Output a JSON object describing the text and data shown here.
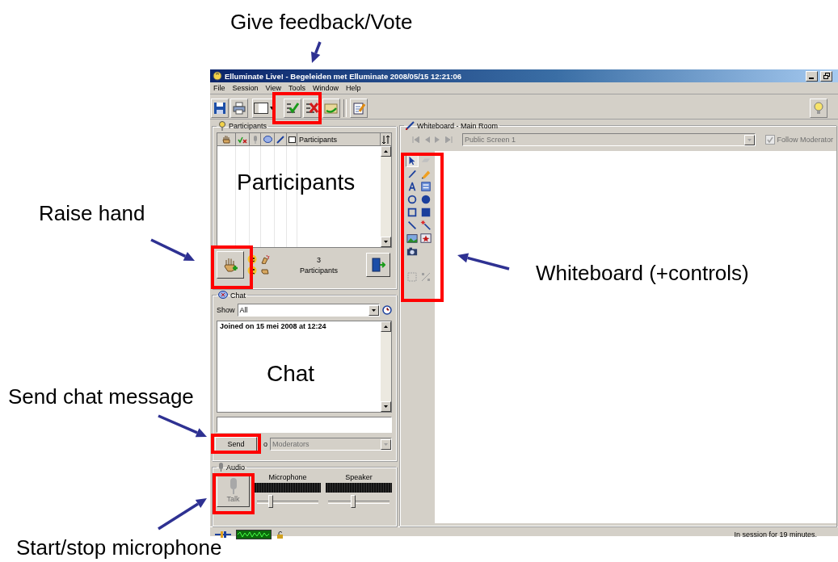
{
  "annotations": [
    {
      "text": "Give feedback/Vote"
    },
    {
      "text": "Participants"
    },
    {
      "text": "Raise hand"
    },
    {
      "text": "Whiteboard (+controls)"
    },
    {
      "text": "Chat"
    },
    {
      "text": "Send chat message"
    },
    {
      "text": "Start/stop microphone"
    }
  ],
  "window": {
    "title": "Elluminate Live! - Begeleiden met Elluminate 2008/05/15 12:21:06"
  },
  "menu": [
    "File",
    "Session",
    "View",
    "Tools",
    "Window",
    "Help"
  ],
  "participants": {
    "title": "Participants",
    "column_header": "Participants",
    "count": "3",
    "count_label": "Participants"
  },
  "chat": {
    "title": "Chat",
    "show_label": "Show",
    "filter": "All",
    "log": [
      "Joined on 15 mei 2008 at 12:24"
    ],
    "send": "Send",
    "to_label": "o",
    "recipient": "Moderators",
    "recipient_disabled": true
  },
  "audio": {
    "title": "Audio",
    "talk": "Talk",
    "talk_disabled": true,
    "channels": [
      {
        "label": "Microphone",
        "level": 0.2
      },
      {
        "label": "Speaker",
        "level": 0.4
      }
    ]
  },
  "whiteboard": {
    "title": "Whiteboard - Main Room",
    "screen": "Public Screen 1",
    "follow_moderator": {
      "label": "Follow Moderator",
      "checked": true,
      "disabled": true
    },
    "tools": [
      {
        "kind": "pointer",
        "selected": true
      },
      {
        "kind": "eraser",
        "selected": false
      },
      {
        "kind": "pen",
        "selected": false
      },
      {
        "kind": "highlighter",
        "selected": false
      },
      {
        "kind": "text",
        "selected": false
      },
      {
        "kind": "textbox",
        "selected": false
      },
      {
        "kind": "ellipse",
        "selected": false
      },
      {
        "kind": "filled-ellipse",
        "selected": false
      },
      {
        "kind": "rectangle",
        "selected": false
      },
      {
        "kind": "filled-rectangle",
        "selected": false
      },
      {
        "kind": "line",
        "selected": false
      },
      {
        "kind": "laser",
        "selected": false
      },
      {
        "kind": "image",
        "selected": false
      },
      {
        "kind": "clipart",
        "selected": false
      },
      {
        "kind": "camera",
        "selected": false
      }
    ]
  },
  "status": "In session for 19 minutes."
}
